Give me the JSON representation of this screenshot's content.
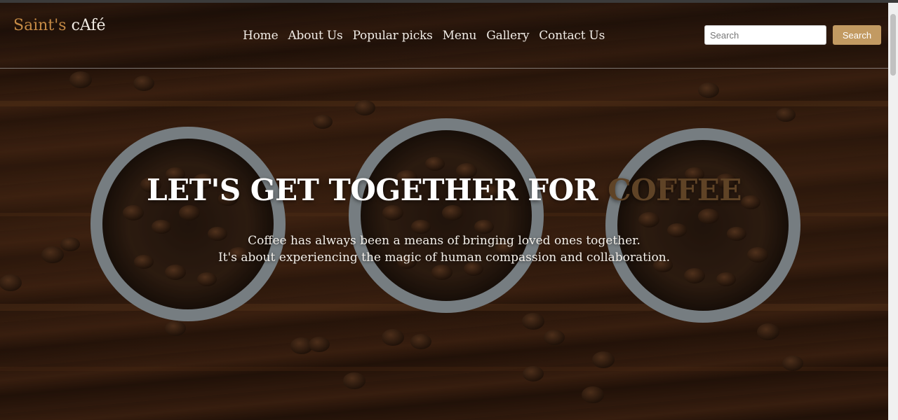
{
  "brand": {
    "part1": "Saint's",
    "part2": "cAfé"
  },
  "nav": {
    "items": [
      {
        "label": "Home"
      },
      {
        "label": "About Us"
      },
      {
        "label": "Popular picks"
      },
      {
        "label": "Menu"
      },
      {
        "label": "Gallery"
      },
      {
        "label": "Contact Us"
      }
    ]
  },
  "search": {
    "placeholder": "Search",
    "button_label": "Search"
  },
  "hero": {
    "headline_main": "LET'S GET TOGETHER FOR ",
    "headline_accent": "COFFEE",
    "subtitle_line1": "Coffee has always been a means of bringing loved ones together.",
    "subtitle_line2": "It's about experiencing the magic of human compassion and collaboration."
  },
  "colors": {
    "brand_accent": "#c58a45",
    "search_button": "#c29a62",
    "headline_accent": "#5f4326"
  },
  "icons": [
    "coffee-bowls-background-image"
  ]
}
